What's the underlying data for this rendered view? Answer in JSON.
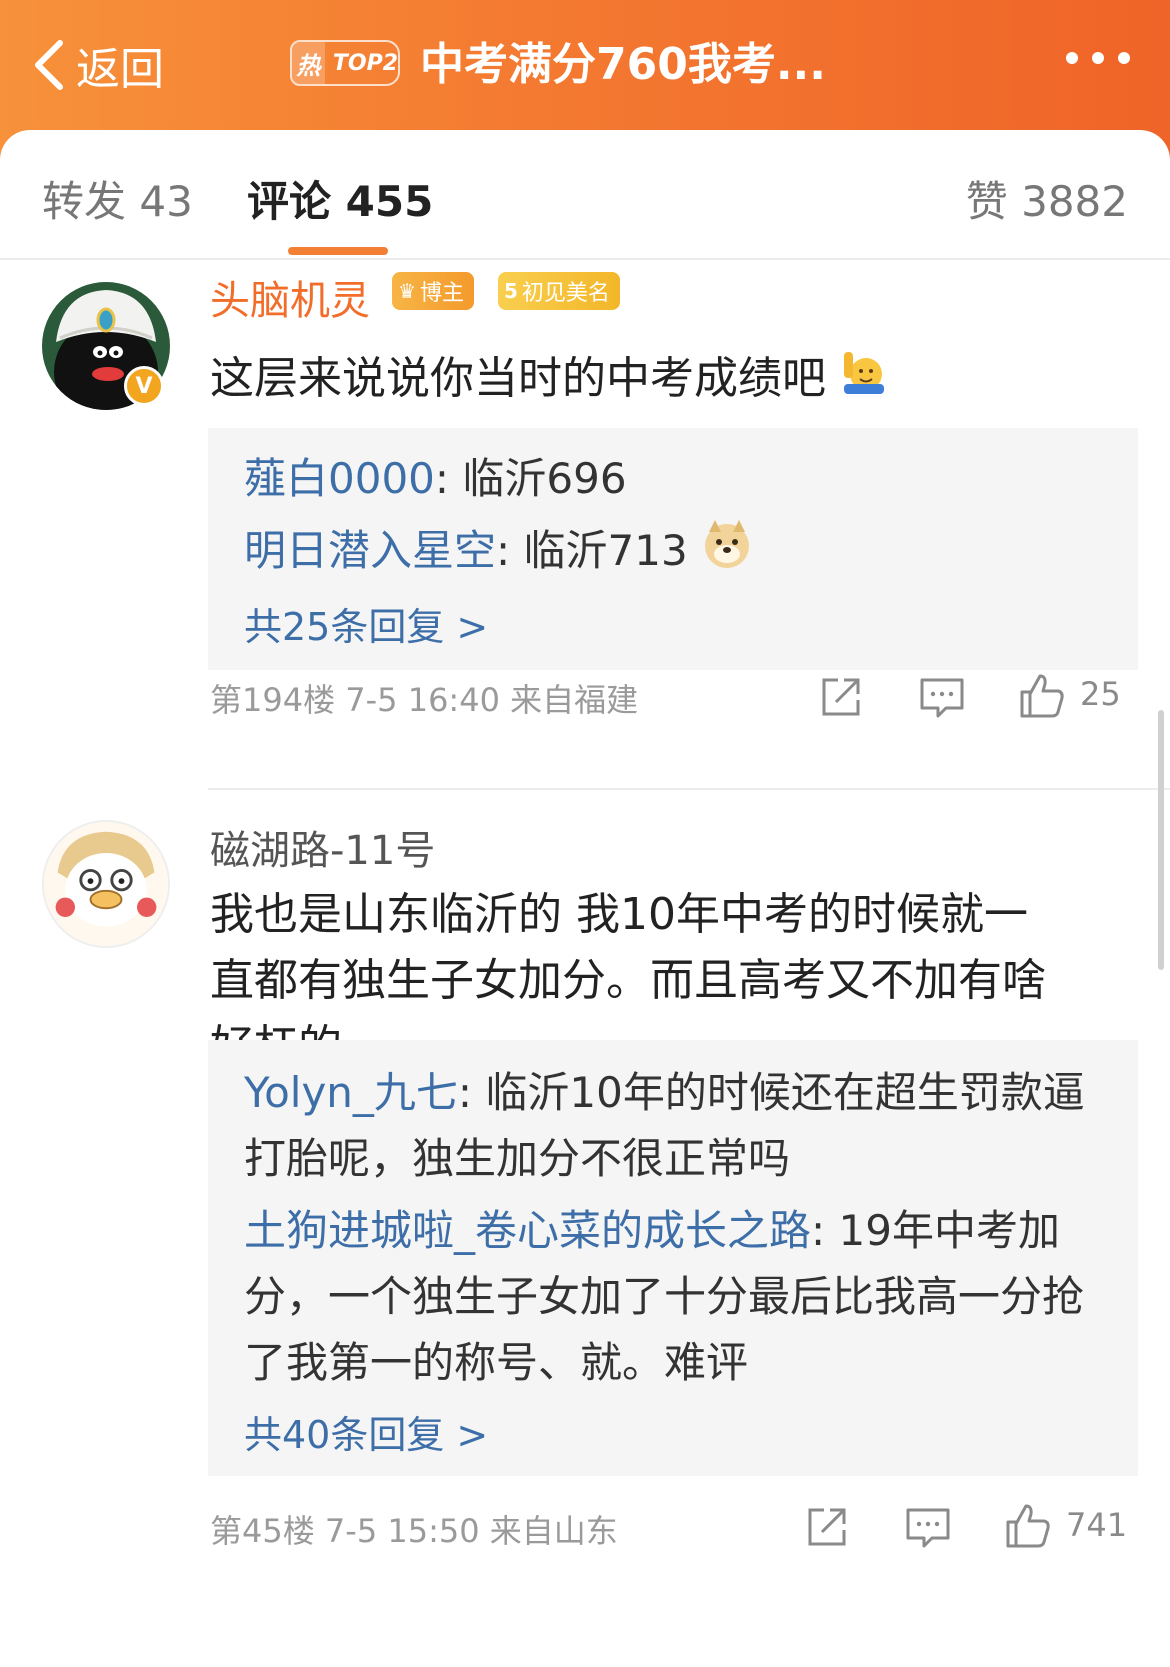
{
  "header": {
    "back_label": "返回",
    "hot_char": "热",
    "hot_rank": "TOP2",
    "title": "中考满分760我考..."
  },
  "tabs": {
    "repost": "转发 43",
    "comment": "评论 455",
    "like": "赞 3882"
  },
  "comments": [
    {
      "username": "头脑机灵",
      "badge_blogger": "博主",
      "badge_level_num": "5",
      "badge_level": "初见美名",
      "verify": "V",
      "text": "这层来说说你当时的中考成绩吧",
      "replies": [
        {
          "user": "薤白0000",
          "text": ": 临沂696"
        },
        {
          "user": "明日潜入星空",
          "text": ": 临沂713"
        }
      ],
      "more_replies": "共25条回复 >",
      "floor": "第194楼",
      "time": "7-5 16:40",
      "location": "来自福建",
      "likes": "25"
    },
    {
      "username": "磁湖路-11号",
      "text": "我也是山东临沂的  我10年中考的时候就一直都有独生子女加分。而且高考又不加有啥好杠的",
      "replies": [
        {
          "user": "Yolyn_九七",
          "text": ": 临沂10年的时候还在超生罚款逼打胎呢，独生加分不很正常吗"
        },
        {
          "user": "土狗进城啦_卷心菜的成长之路",
          "text": ": 19年中考加分，一个独生子女加了十分最后比我高一分抢了我第一的称号、就。难评"
        }
      ],
      "more_replies": "共40条回复 >",
      "floor": "第45楼",
      "time": "7-5 15:50",
      "location": "来自山东",
      "likes": "741"
    }
  ],
  "icons": {
    "back": "chevron-left-icon",
    "more": "more-dots-icon",
    "share": "share-icon",
    "reply": "comment-icon",
    "like": "thumb-up-icon"
  },
  "colors": {
    "header_gradient_start": "#f7913a",
    "header_gradient_end": "#ef6428",
    "username_highlight": "#f26c2a",
    "reply_user": "#3d6ea8",
    "tab_indicator": "#f27f33"
  }
}
